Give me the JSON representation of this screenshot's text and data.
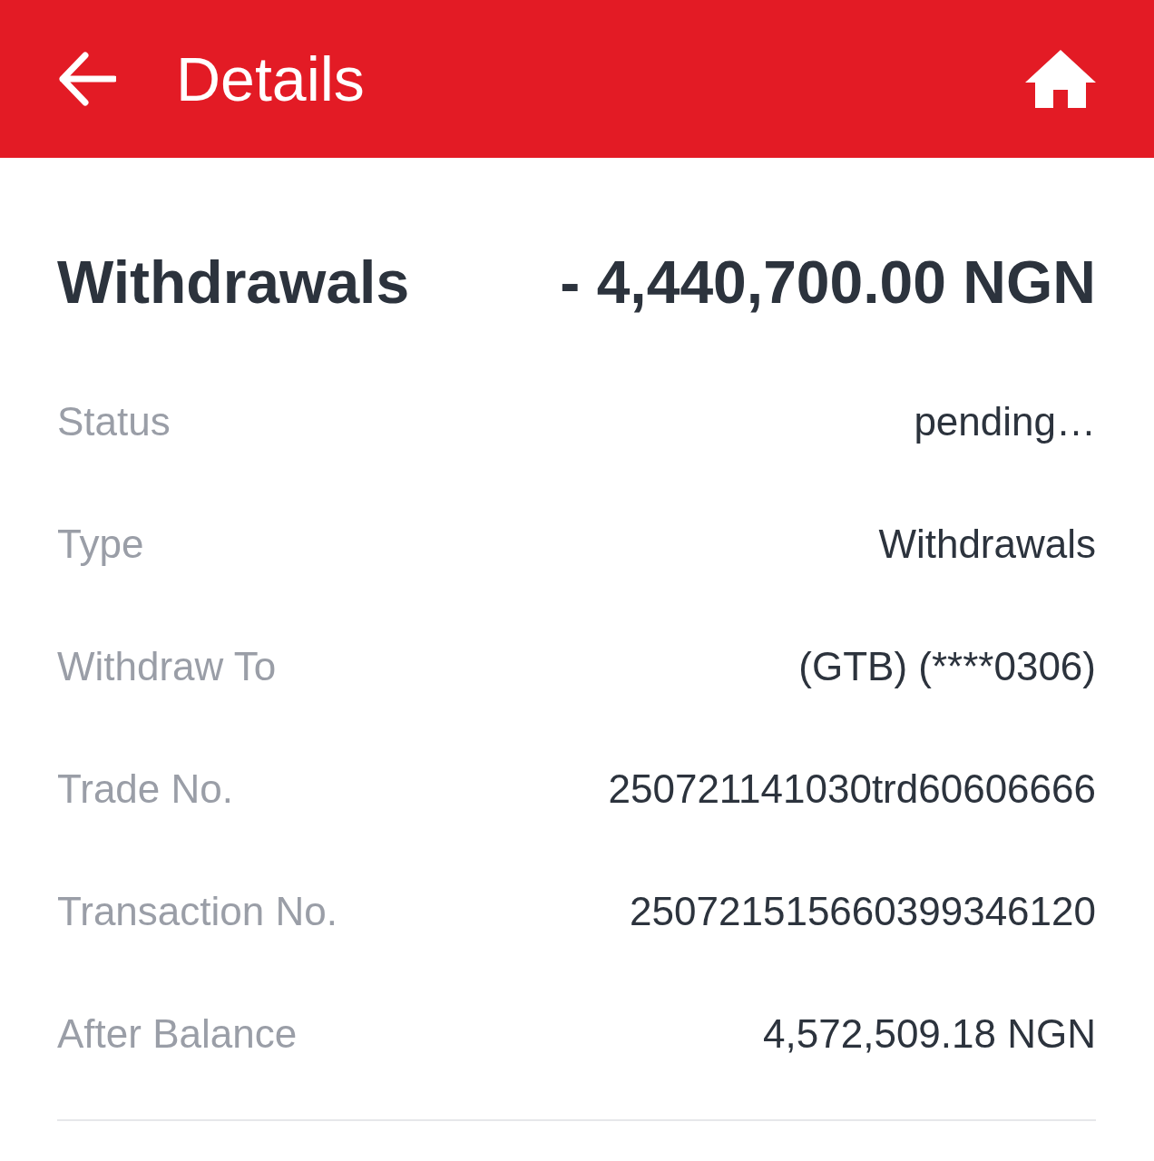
{
  "header": {
    "title": "Details"
  },
  "summary": {
    "label": "Withdrawals",
    "amount": "- 4,440,700.00 NGN"
  },
  "rows": [
    {
      "label": "Status",
      "value": "pending…"
    },
    {
      "label": "Type",
      "value": "Withdrawals"
    },
    {
      "label": "Withdraw To",
      "value": "(GTB) (****0306)"
    },
    {
      "label": "Trade No.",
      "value": "250721141030trd60606666"
    },
    {
      "label": "Transaction No.",
      "value": "250721515660399346120"
    },
    {
      "label": "After Balance",
      "value": "4,572,509.18 NGN"
    }
  ]
}
